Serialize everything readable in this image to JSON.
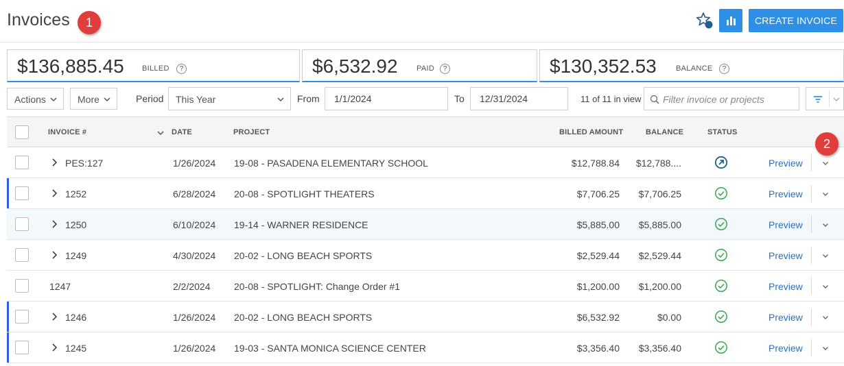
{
  "header": {
    "title": "Invoices",
    "create_button": "CREATE INVOICE",
    "favorite_icon": "star-icon",
    "reports_icon": "bar-chart-icon"
  },
  "annotations": [
    "1",
    "2"
  ],
  "summary": {
    "billed": {
      "amount": "$136,885.45",
      "label": "BILLED"
    },
    "paid": {
      "amount": "$6,532.92",
      "label": "PAID"
    },
    "balance": {
      "amount": "$130,352.53",
      "label": "BALANCE"
    },
    "help": "?"
  },
  "toolbar": {
    "actions": "Actions",
    "more": "More",
    "period_label": "Period",
    "period_value": "This Year",
    "from_label": "From",
    "from_value": "1/1/2024",
    "to_label": "To",
    "to_value": "12/31/2024",
    "in_view": "11 of 11 in view",
    "search_placeholder": "Filter invoice or projects"
  },
  "table": {
    "columns": {
      "invoice": "INVOICE #",
      "date": "DATE",
      "project": "PROJECT",
      "billed": "BILLED AMOUNT",
      "balance": "BALANCE",
      "status": "STATUS"
    },
    "preview_label": "Preview",
    "rows": [
      {
        "invoice": "PES:127",
        "date": "1/26/2024",
        "project": "19-08 - PASADENA ELEMENTARY SCHOOL",
        "billed": "$12,788.84",
        "balance": "$12,788....",
        "status": "sent",
        "expandable": true,
        "accent": false,
        "highlight": false
      },
      {
        "invoice": "1252",
        "date": "6/28/2024",
        "project": "20-08 - SPOTLIGHT THEATERS",
        "billed": "$7,706.25",
        "balance": "$7,706.25",
        "status": "approved",
        "expandable": true,
        "accent": true,
        "highlight": false
      },
      {
        "invoice": "1250",
        "date": "6/10/2024",
        "project": "19-14 - WARNER RESIDENCE",
        "billed": "$5,885.00",
        "balance": "$5,885.00",
        "status": "approved",
        "expandable": true,
        "accent": false,
        "highlight": true
      },
      {
        "invoice": "1249",
        "date": "4/30/2024",
        "project": "20-02 - LONG BEACH SPORTS",
        "billed": "$2,529.44",
        "balance": "$2,529.44",
        "status": "approved",
        "expandable": true,
        "accent": false,
        "highlight": false
      },
      {
        "invoice": "1247",
        "date": "2/2/2024",
        "project": "20-08 - SPOTLIGHT: Change Order #1",
        "billed": "$1,200.00",
        "balance": "$1,200.00",
        "status": "approved",
        "expandable": false,
        "accent": false,
        "highlight": false
      },
      {
        "invoice": "1246",
        "date": "1/26/2024",
        "project": "20-02 - LONG BEACH SPORTS",
        "billed": "$6,532.92",
        "balance": "$0.00",
        "status": "approved",
        "expandable": true,
        "accent": true,
        "highlight": false
      },
      {
        "invoice": "1245",
        "date": "1/26/2024",
        "project": "19-03 - SANTA MONICA SCIENCE CENTER",
        "billed": "$3,356.40",
        "balance": "$3,356.40",
        "status": "approved",
        "expandable": true,
        "accent": true,
        "highlight": false
      }
    ]
  },
  "colors": {
    "primary": "#2d8fe6",
    "accent_bar": "#2d5fe6",
    "approved": "#3aa64c",
    "sent": "#1f5f8f",
    "badge": "#e23d3d",
    "link": "#2a6fbf"
  }
}
